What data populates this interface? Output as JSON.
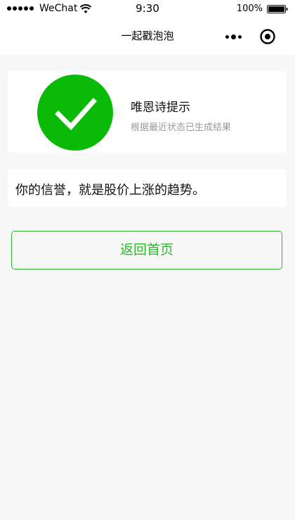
{
  "status_bar": {
    "carrier": "WeChat",
    "time": "9:30",
    "battery": "100%"
  },
  "nav": {
    "title": "一起戳泡泡"
  },
  "result": {
    "title": "唯恩诗提示",
    "subtitle": "根据最近状态已生成结果",
    "icon": "checkmark-circle-icon",
    "icon_color": "#09bb07"
  },
  "message": {
    "text": "你的信誉，就是股价上涨的趋势。"
  },
  "actions": {
    "home_label": "返回首页",
    "accent_color": "#2fb52f"
  }
}
